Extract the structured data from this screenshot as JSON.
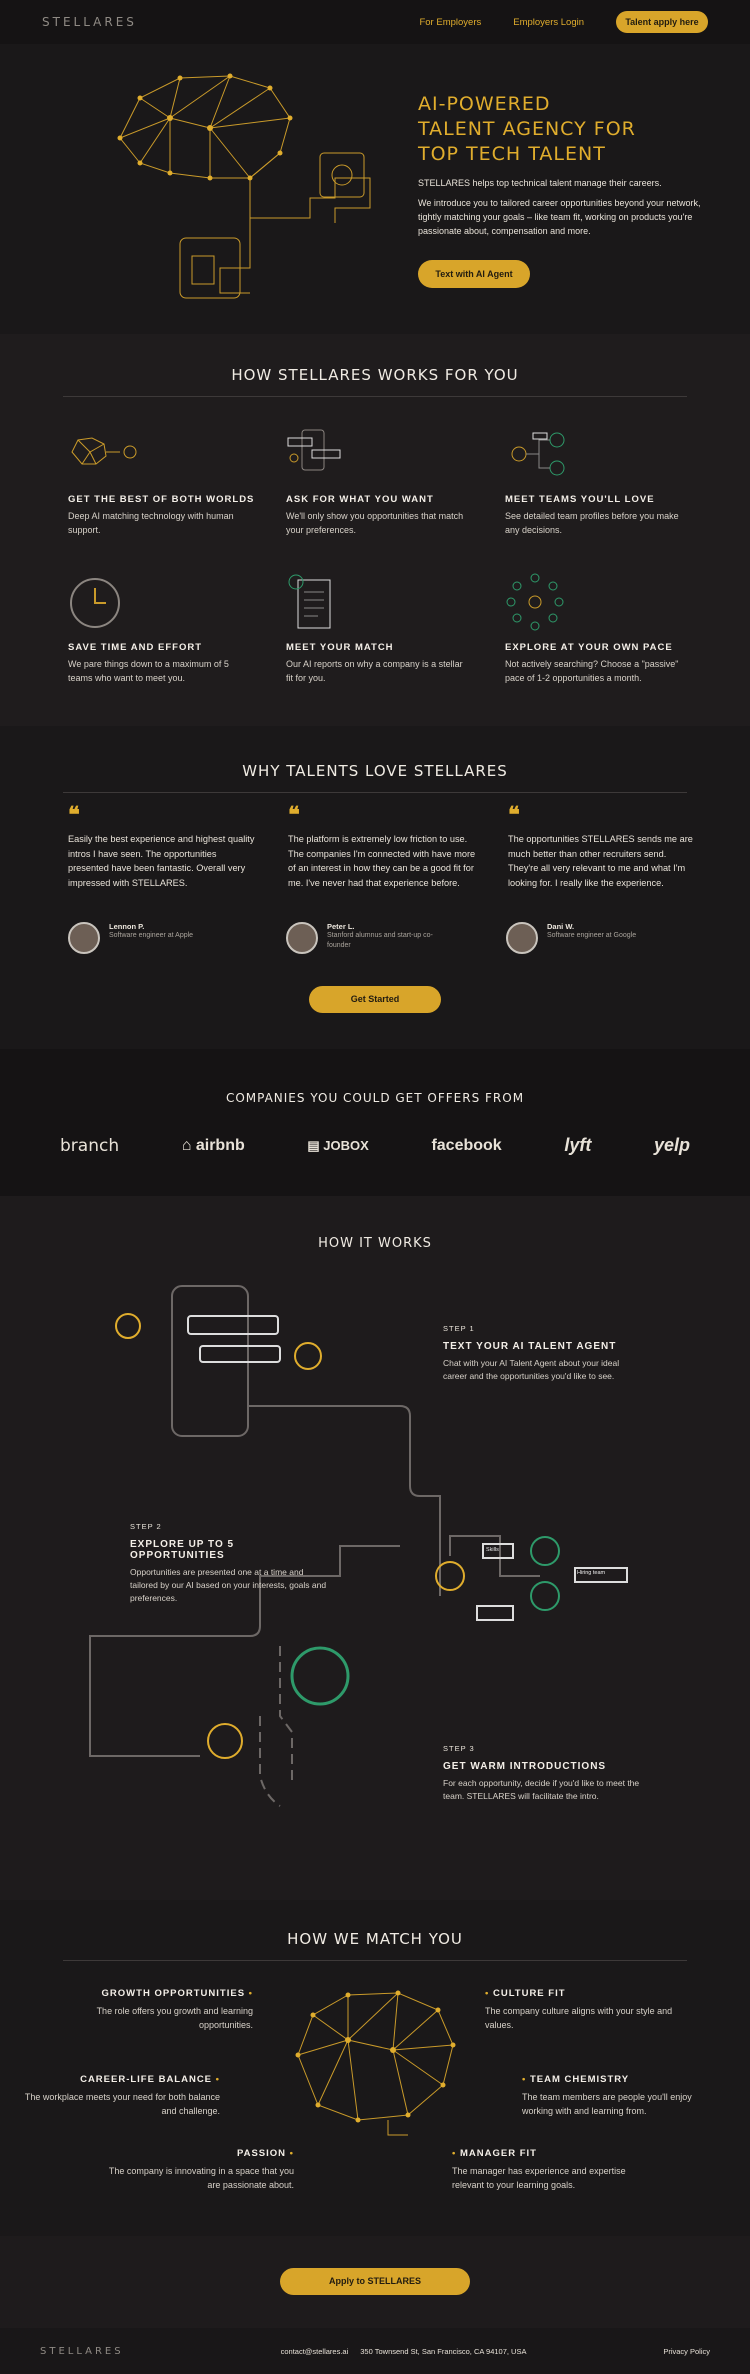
{
  "nav": {
    "logo": "STELLARES",
    "for_employers": "For Employers",
    "employers_login": "Employers Login",
    "talent_apply": "Talent apply here"
  },
  "hero": {
    "title_lines": [
      "AI-POWERED",
      "TALENT AGENCY FOR",
      "TOP TECH TALENT"
    ],
    "intro": "STELLARES helps top technical talent manage their careers.",
    "body": "We introduce you to tailored career opportunities beyond your network, tightly matching your goals – like team fit, working on products you're passionate about, compensation and more.",
    "cta": "Text with AI Agent"
  },
  "how_works": {
    "title": "HOW STELLARES WORKS FOR YOU",
    "features": [
      {
        "title": "GET THE BEST OF BOTH WORLDS",
        "text": "Deep AI matching technology with human support.",
        "icon": "brain-coin-icon"
      },
      {
        "title": "ASK FOR WHAT YOU WANT",
        "text": "We'll only show you opportunities that match your preferences.",
        "icon": "phone-chat-icon"
      },
      {
        "title": "MEET TEAMS YOU'LL LOVE",
        "text": "See detailed team profiles before you make any decisions.",
        "icon": "team-network-icon"
      },
      {
        "title": "SAVE TIME AND EFFORT",
        "text": "We pare things down to a maximum of 5 teams who want to meet you.",
        "icon": "clock-icon"
      },
      {
        "title": "MEET YOUR MATCH",
        "text": "Our AI reports on why a company is a stellar fit for you.",
        "icon": "report-icon"
      },
      {
        "title": "EXPLORE AT YOUR OWN PACE",
        "text": "Not actively searching? Choose a \"passive\" pace of 1-2 opportunities a month.",
        "icon": "circle-people-icon"
      }
    ]
  },
  "testimonials": {
    "title": "WHY TALENTS LOVE STELLARES",
    "items": [
      {
        "quote": "Easily the best experience and highest quality intros I have seen. The opportunities presented have been fantastic. Overall very impressed with STELLARES.",
        "name": "Lennon P.",
        "role": "Software engineer at Apple"
      },
      {
        "quote": "The platform is extremely low friction to use. The companies I'm connected with have more of an interest in how they can be a good fit for me. I've never had that experience before.",
        "name": "Peter L.",
        "role": "Stanford alumnus and start-up co-founder"
      },
      {
        "quote": "The opportunities STELLARES sends me are much better than other recruiters send. They're all very relevant to me and what I'm looking for. I really like the experience.",
        "name": "Dani W.",
        "role": "Software engineer at Google"
      }
    ],
    "cta": "Get Started"
  },
  "companies": {
    "title": "COMPANIES YOU COULD GET OFFERS FROM",
    "logos": [
      "branch",
      "airbnb",
      "JOBOX",
      "facebook",
      "lyft",
      "yelp"
    ]
  },
  "how_it_works": {
    "title": "HOW IT WORKS",
    "steps": [
      {
        "num": "STEP 1",
        "title": "TEXT YOUR AI TALENT AGENT",
        "text": "Chat with your AI Talent Agent about your ideal career and the opportunities you'd like to see."
      },
      {
        "num": "STEP 2",
        "title": "EXPLORE UP TO 5 OPPORTUNITIES",
        "text": "Opportunities are presented one at a time and tailored by our AI based on your interests, goals and preferences."
      },
      {
        "num": "STEP 3",
        "title": "GET WARM INTRODUCTIONS",
        "text": "For each opportunity, decide if you'd like to meet the team. STELLARES will facilitate the intro."
      }
    ],
    "labels": {
      "skills": "Skills",
      "hiring_team": "Hiring team"
    }
  },
  "match": {
    "title": "HOW WE MATCH YOU",
    "items": [
      {
        "title": "GROWTH OPPORTUNITIES",
        "text": "The role offers you growth and learning opportunities."
      },
      {
        "title": "CULTURE FIT",
        "text": "The company culture aligns with your style and values."
      },
      {
        "title": "CAREER-LIFE BALANCE",
        "text": "The workplace meets your need for both balance and challenge."
      },
      {
        "title": "TEAM CHEMISTRY",
        "text": "The team members are people you'll enjoy working with and learning from."
      },
      {
        "title": "PASSION",
        "text": "The company is innovating in a space that you are passionate about."
      },
      {
        "title": "MANAGER FIT",
        "text": "The manager has experience and expertise relevant to your learning goals."
      }
    ]
  },
  "apply_cta": "Apply to STELLARES",
  "footer": {
    "logo": "STELLARES",
    "email": "contact@stellares.ai",
    "address": "350 Townsend St, San Francisco, CA 94107, USA",
    "privacy": "Privacy Policy"
  },
  "colors": {
    "gold": "#e0ad2d",
    "green": "#2e9a6a",
    "bg": "#1e1b1c"
  }
}
